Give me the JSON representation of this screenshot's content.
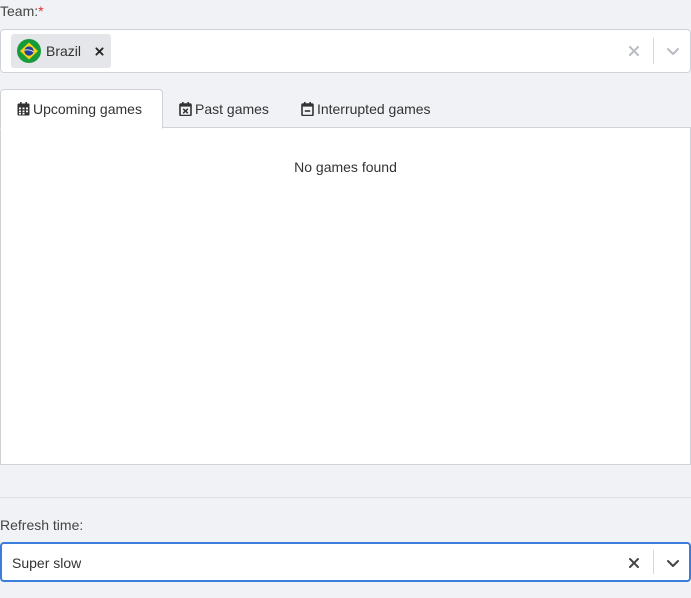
{
  "team": {
    "label": "Team:",
    "required_mark": "*",
    "selected": [
      {
        "name": "Brazil",
        "flag_icon": "brazil-flag-icon"
      }
    ]
  },
  "tabs": [
    {
      "label": "Upcoming games",
      "icon": "calendar-icon",
      "active": true
    },
    {
      "label": "Past games",
      "icon": "calendar-x-icon",
      "active": false
    },
    {
      "label": "Interrupted games",
      "icon": "calendar-minus-icon",
      "active": false
    }
  ],
  "panel": {
    "empty_message": "No games found"
  },
  "refresh": {
    "label": "Refresh time:",
    "value": "Super slow"
  },
  "colors": {
    "focus_border": "#3b7ddd",
    "required": "#e03131",
    "background": "#f0f2f5"
  }
}
